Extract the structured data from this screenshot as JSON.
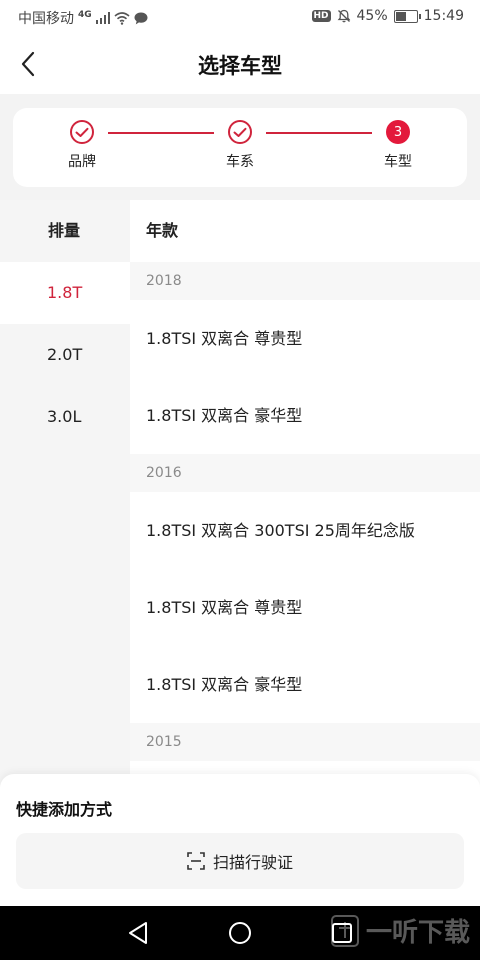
{
  "status_bar": {
    "carrier": "中国移动",
    "network": "4G",
    "hd": "HD",
    "battery": "45%",
    "battery_level": 0.45,
    "time": "15:49"
  },
  "header": {
    "title": "选择车型"
  },
  "steps": [
    {
      "label": "品牌",
      "state": "done"
    },
    {
      "label": "车系",
      "state": "done"
    },
    {
      "label": "车型",
      "state": "active",
      "number": "3"
    }
  ],
  "columns": {
    "left_header": "排量",
    "right_header": "年款"
  },
  "displacements": [
    {
      "label": "1.8T",
      "selected": true
    },
    {
      "label": "2.0T",
      "selected": false
    },
    {
      "label": "3.0L",
      "selected": false
    }
  ],
  "model_groups": [
    {
      "year": "2018",
      "models": [
        "1.8TSI 双离合 尊贵型",
        "1.8TSI 双离合 豪华型"
      ]
    },
    {
      "year": "2016",
      "models": [
        "1.8TSI 双离合 300TSI 25周年纪念版",
        "1.8TSI 双离合 尊贵型",
        "1.8TSI 双离合 豪华型"
      ]
    },
    {
      "year": "2015",
      "models": []
    }
  ],
  "bottom_sheet": {
    "title": "快捷添加方式",
    "scan_label": "扫描行驶证"
  },
  "watermark": {
    "text": "一听下载"
  },
  "colors": {
    "accent": "#d0243c",
    "active_step": "#e3193b",
    "muted_bg": "#f5f5f5"
  }
}
